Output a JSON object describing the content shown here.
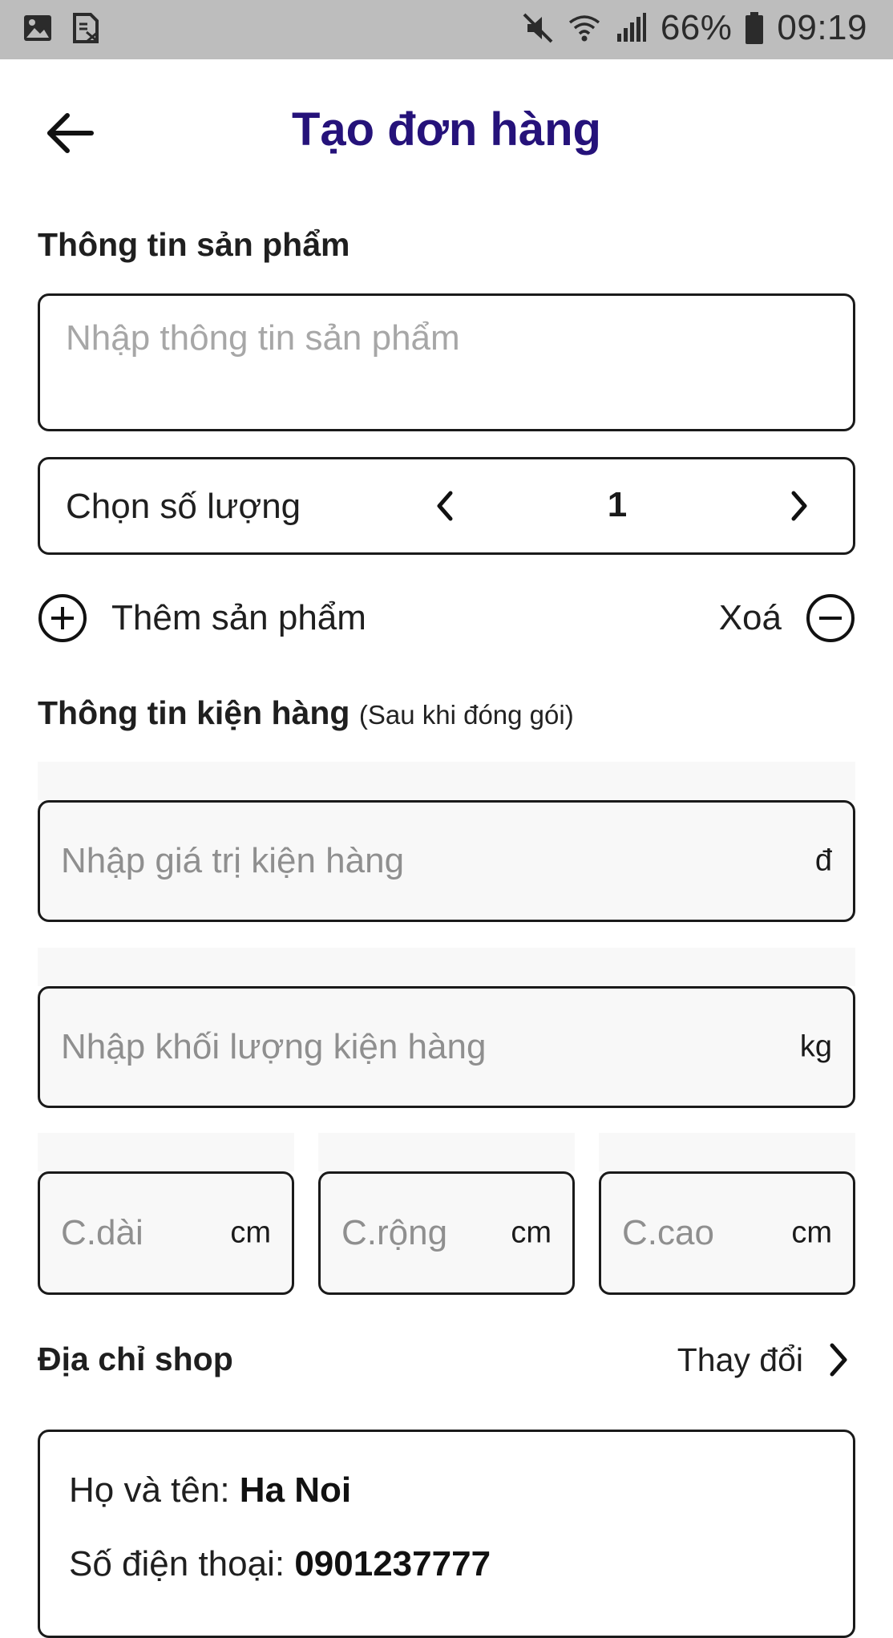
{
  "status_bar": {
    "battery": "66%",
    "time": "09:19",
    "icons": [
      "gallery-icon",
      "sim-off-icon",
      "mute-icon",
      "wifi-icon",
      "signal-icon",
      "battery-icon"
    ]
  },
  "header": {
    "title": "Tạo đơn hàng",
    "back_icon": "arrow-left-icon"
  },
  "product_section": {
    "title": "Thông tin sản phẩm",
    "product_input": {
      "value": "",
      "placeholder": "Nhập thông tin sản phẩm"
    },
    "quantity": {
      "label": "Chọn số lượng",
      "value": "1"
    },
    "add_label": "Thêm sản phẩm",
    "delete_label": "Xoá"
  },
  "package_section": {
    "title": "Thông tin kiện hàng",
    "subtitle": "(Sau khi đóng gói)",
    "value_field": {
      "value": "",
      "placeholder": "Nhập giá trị kiện hàng",
      "unit": "đ"
    },
    "weight_field": {
      "value": "",
      "placeholder": "Nhập khối lượng kiện hàng",
      "unit": "kg"
    },
    "length_field": {
      "value": "",
      "placeholder": "C.dài",
      "unit": "cm"
    },
    "width_field": {
      "value": "",
      "placeholder": "C.rộng",
      "unit": "cm"
    },
    "height_field": {
      "value": "",
      "placeholder": "C.cao",
      "unit": "cm"
    }
  },
  "shop_section": {
    "title": "Địa chỉ shop",
    "change_label": "Thay đổi",
    "name_label": "Họ và tên:",
    "name_value": "Ha Noi",
    "phone_label": "Số điện thoại:",
    "phone_value": "0901237777"
  },
  "colors": {
    "title": "#25127a",
    "statusbar": "#bdbdbd",
    "field_bg": "#f8f8f8",
    "border": "#1a1a1a"
  }
}
